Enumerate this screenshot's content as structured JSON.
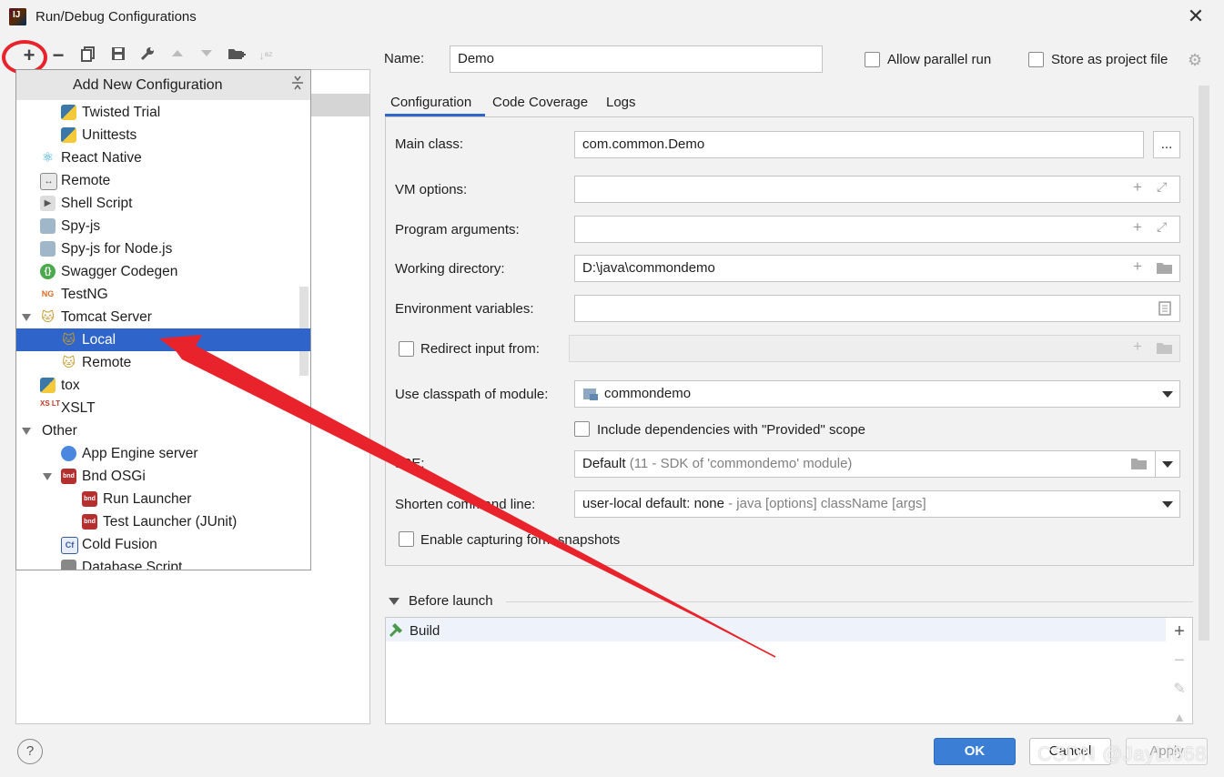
{
  "window": {
    "title": "Run/Debug Configurations",
    "app_icon_letter": "IJ"
  },
  "toolbar": {
    "items": [
      "add-icon",
      "remove-icon",
      "copy-icon",
      "save-icon",
      "wrench-icon",
      "move-up-icon",
      "move-down-icon",
      "folder-add-icon",
      "sort-icon"
    ]
  },
  "popup": {
    "title": "Add New Configuration",
    "items": [
      {
        "label": "Twisted Trial",
        "icon": "python-icon",
        "indent": 2
      },
      {
        "label": "Unittests",
        "icon": "python-icon",
        "indent": 2
      },
      {
        "label": "React Native",
        "icon": "react-icon",
        "indent": 1
      },
      {
        "label": "Remote",
        "icon": "remote-icon",
        "indent": 1
      },
      {
        "label": "Shell Script",
        "icon": "shell-icon",
        "indent": 1
      },
      {
        "label": "Spy-js",
        "icon": "spy-icon",
        "indent": 1
      },
      {
        "label": "Spy-js for Node.js",
        "icon": "spy-node-icon",
        "indent": 1
      },
      {
        "label": "Swagger Codegen",
        "icon": "swagger-icon",
        "indent": 1
      },
      {
        "label": "TestNG",
        "icon": "testng-icon",
        "indent": 1
      },
      {
        "label": "Tomcat Server",
        "icon": "tomcat-icon",
        "indent": 1,
        "expanded": true
      },
      {
        "label": "Local",
        "icon": "tomcat-icon",
        "indent": 2,
        "selected": true
      },
      {
        "label": "Remote",
        "icon": "tomcat-icon",
        "indent": 2
      },
      {
        "label": "tox",
        "icon": "python-icon",
        "indent": 1
      },
      {
        "label": "XSLT",
        "icon": "xslt-icon",
        "indent": 1
      },
      {
        "label": "Other",
        "icon": "",
        "indent": 0,
        "expanded": true
      },
      {
        "label": "App Engine server",
        "icon": "app-engine-icon",
        "indent": 2
      },
      {
        "label": "Bnd OSGi",
        "icon": "bnd-icon",
        "indent": 2,
        "expanded": true
      },
      {
        "label": "Run Launcher",
        "icon": "bnd-run-icon",
        "indent": 3
      },
      {
        "label": "Test Launcher (JUnit)",
        "icon": "bnd-test-icon",
        "indent": 3
      },
      {
        "label": "Cold Fusion",
        "icon": "cold-fusion-icon",
        "indent": 2
      },
      {
        "label": "Database Script",
        "icon": "database-icon",
        "indent": 2
      }
    ]
  },
  "config": {
    "name_label": "Name:",
    "name_value": "Demo",
    "allow_parallel_label": "Allow parallel run",
    "store_project_label": "Store as project file",
    "tabs": [
      "Configuration",
      "Code Coverage",
      "Logs"
    ],
    "main_class_label": "Main class:",
    "main_class_value": "com.common.Demo",
    "browse_label": "...",
    "vm_options_label": "VM options:",
    "vm_options_value": "",
    "program_args_label": "Program arguments:",
    "program_args_value": "",
    "working_dir_label": "Working directory:",
    "working_dir_value": "D:\\java\\commondemo",
    "env_vars_label": "Environment variables:",
    "env_vars_value": "",
    "redirect_label": "Redirect input from:",
    "classpath_label": "Use classpath of module:",
    "classpath_value": "commondemo",
    "include_deps_label": "Include dependencies with \"Provided\" scope",
    "jre_label": "JRE:",
    "jre_value": "Default",
    "jre_hint": "(11 - SDK of 'commondemo' module)",
    "shorten_label": "Shorten command line:",
    "shorten_value": "user-local default: none",
    "shorten_hint": "- java [options] className [args]",
    "capture_label": "Enable capturing form snapshots"
  },
  "before_launch": {
    "title": "Before launch",
    "tasks": [
      {
        "label": "Build",
        "icon": "hammer-icon"
      }
    ]
  },
  "buttons": {
    "ok": "OK",
    "cancel": "Cancel",
    "apply": "Apply",
    "help": "?"
  },
  "watermark": "CSDN @JayLi668",
  "colors": {
    "accent": "#2f65ca",
    "annotation_red": "#e8232b",
    "ok_button": "#3a7ed6"
  }
}
